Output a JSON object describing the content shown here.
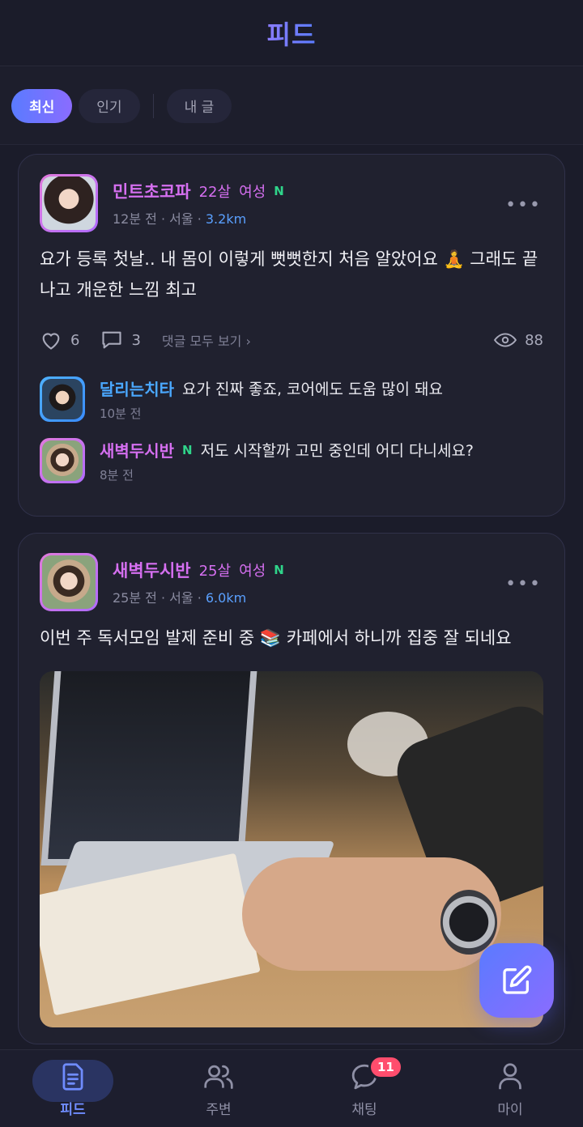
{
  "header": {
    "title": "피드"
  },
  "tabs": [
    {
      "label": "최신",
      "active": true
    },
    {
      "label": "인기",
      "active": false
    },
    {
      "label": "내 글",
      "active": false
    }
  ],
  "posts": [
    {
      "author": {
        "name": "민트초코파",
        "age": "22살",
        "gender": "여성",
        "badge": "N",
        "time": "12분 전",
        "location": "서울",
        "distance": "3.2km"
      },
      "text": "요가 등록 첫날.. 내 몸이 이렇게 뻣뻣한지 처음 알았어요 🧘 그래도 끝나고 개운한 느낌 최고",
      "likes": "6",
      "comments_count": "3",
      "view_all_label": "댓글 모두 보기 ›",
      "views": "88",
      "comments": [
        {
          "name": "달리는치타",
          "badge": "",
          "text": "요가 진짜 좋죠, 코어에도 도움 많이 돼요",
          "time": "10분 전"
        },
        {
          "name": "새벽두시반",
          "badge": "N",
          "text": "저도 시작할까 고민 중인데 어디 다니세요?",
          "time": "8분 전"
        }
      ]
    },
    {
      "author": {
        "name": "새벽두시반",
        "age": "25살",
        "gender": "여성",
        "badge": "N",
        "time": "25분 전",
        "location": "서울",
        "distance": "6.0km"
      },
      "text": "이번 주 독서모임 발제 준비 중 📚 카페에서 하니까 집중 잘 되네요"
    }
  ],
  "nav": [
    {
      "label": "피드",
      "icon": "document-icon",
      "active": true
    },
    {
      "label": "주변",
      "icon": "people-icon",
      "active": false
    },
    {
      "label": "채팅",
      "icon": "chat-icon",
      "active": false,
      "badge": "11"
    },
    {
      "label": "마이",
      "icon": "person-icon",
      "active": false
    }
  ],
  "colors": {
    "accent": "#6f8cff",
    "name_pink": "#d56ff0",
    "name_blue": "#4aa8ff",
    "badge_green": "#2fd48a",
    "badge_red": "#ff4d6d"
  }
}
